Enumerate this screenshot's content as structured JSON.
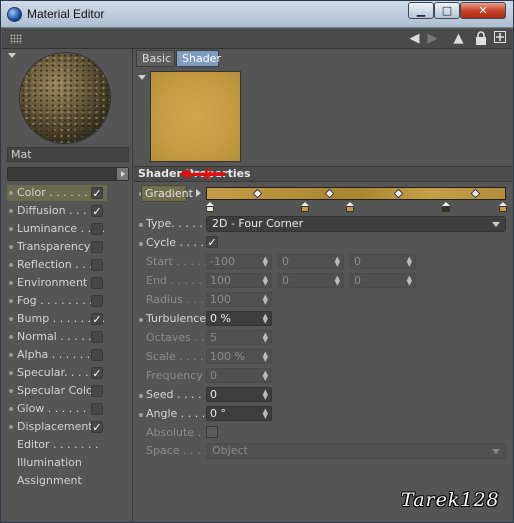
{
  "window": {
    "title": "Material Editor"
  },
  "material": {
    "name": "Mat"
  },
  "channels": [
    {
      "label": "Color . . . . . .",
      "checked": true,
      "active": true
    },
    {
      "label": "Diffusion . . . . .",
      "checked": true
    },
    {
      "label": "Luminance . . . .",
      "checked": false
    },
    {
      "label": "Transparency",
      "checked": false
    },
    {
      "label": "Reflection . . . .",
      "checked": false
    },
    {
      "label": "Environment",
      "checked": false
    },
    {
      "label": "Fog . . . . . . . . .",
      "checked": false
    },
    {
      "label": "Bump . . . . . . . .",
      "checked": true
    },
    {
      "label": "Normal . . . . . .",
      "checked": false
    },
    {
      "label": "Alpha . . . . . . .",
      "checked": false
    },
    {
      "label": "Specular. . . . . .",
      "checked": true
    },
    {
      "label": "Specular Color",
      "checked": false
    },
    {
      "label": "Glow . . . . . . . .",
      "checked": false
    },
    {
      "label": "Displacement",
      "checked": true
    }
  ],
  "extra_items": [
    "Editor . . . . . . .",
    "Illumination",
    "Assignment"
  ],
  "tabs": {
    "basic": "Basic",
    "shader": "Shader"
  },
  "section": {
    "title": "Shader Properties"
  },
  "props": {
    "gradient": "Gradient",
    "type_label": "Type. . . . .",
    "type_value": "2D - Four Corner",
    "cycle": "Cycle . . . .",
    "start": "Start . . . . .",
    "start_values": [
      "-100",
      "0",
      "0"
    ],
    "end": "End . . . . . .",
    "end_values": [
      "100",
      "0",
      "0"
    ],
    "radius": "Radius . . . .",
    "radius_value": "100",
    "turbulence": "Turbulence",
    "turbulence_value": "0 %",
    "octaves": "Octaves . . .",
    "octaves_value": "5",
    "scale": "Scale . . . . .",
    "scale_value": "100 %",
    "frequency": "Frequency",
    "frequency_value": "0",
    "seed": "Seed . . . . .",
    "seed_value": "0",
    "angle": "Angle . . . . .",
    "angle_value": "0 °",
    "absolute": "Absolute . .",
    "space": "Space . . . .",
    "space_value": "Object"
  },
  "watermark": "Tarek128",
  "colors": {
    "accent_tab": "#7e9cbf",
    "gradient_gold": "#c59c45",
    "annotation_red": "#e01010"
  },
  "icons": [
    "material-app-icon",
    "minimize-icon",
    "maximize-icon",
    "close-icon",
    "back-arrow-icon",
    "forward-arrow-icon",
    "up-arrow-icon",
    "lock-icon",
    "new-window-icon"
  ]
}
